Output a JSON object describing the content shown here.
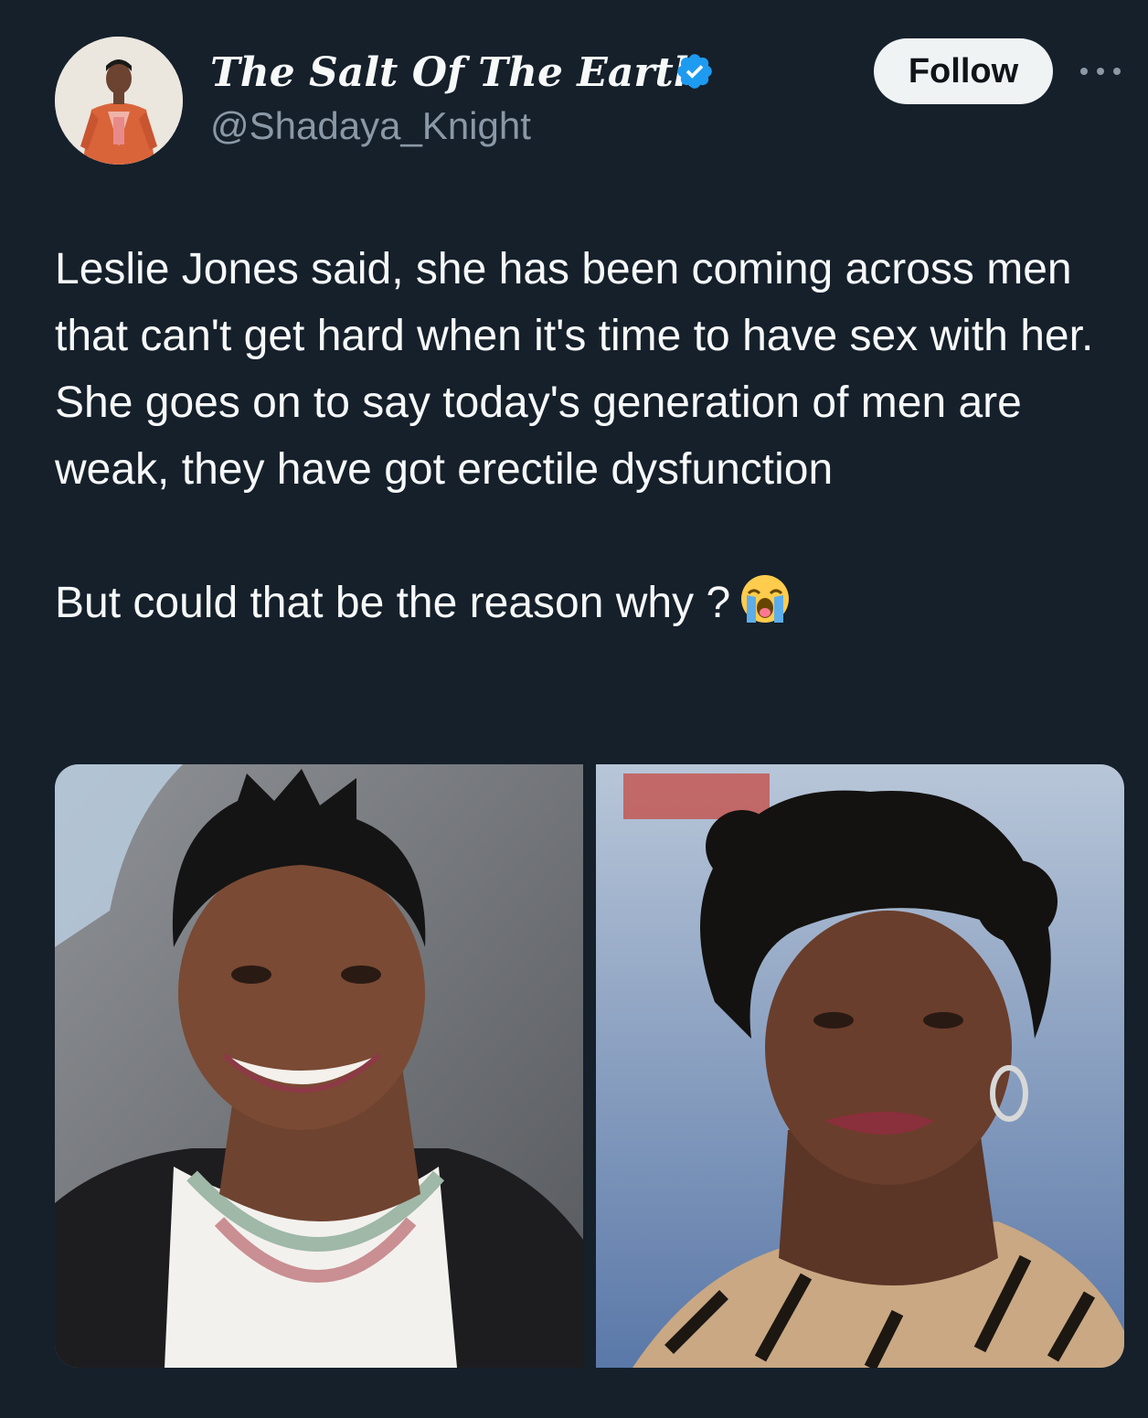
{
  "tweet": {
    "author": {
      "display_name": "The Salt Of The Earth",
      "handle": "@Shadaya_Knight",
      "verified": true,
      "badge_color": "#1d9bf0"
    },
    "follow_label": "Follow",
    "more_icon": "more-horizontal-icon",
    "text": {
      "paragraph1": "Leslie Jones said, she has been coming across men that can't get hard when it's time to have sex with her. She goes on to say today's generation of men are weak, they have got erectile dysfunction",
      "paragraph2": "But could that be the reason why ?",
      "emoji": "loudly-crying-face"
    },
    "media": [
      {
        "kind": "photo",
        "description_icon": "photo-left"
      },
      {
        "kind": "photo",
        "description_icon": "photo-right"
      }
    ]
  },
  "theme": {
    "background": "#15202b",
    "text": "#f7f9f9",
    "secondary_text": "#8b98a5",
    "follow_bg": "#eff3f4"
  }
}
